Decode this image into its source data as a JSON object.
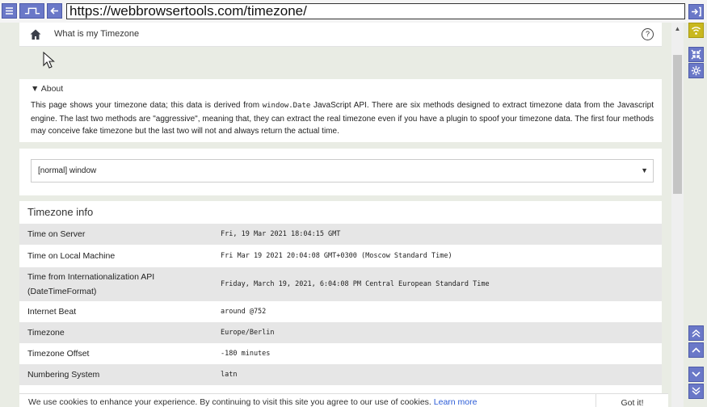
{
  "browser": {
    "url": "https://webbrowsertools.com/timezone/"
  },
  "header": {
    "title": "What is my Timezone",
    "help_label": "?"
  },
  "about": {
    "title": "▼ About",
    "text_1": "This page shows your timezone data; this data is derived from ",
    "code": "window.Date",
    "text_2": " JavaScript API. There are six methods designed to extract timezone data from the Javascript engine. The last two methods are \"aggressive\", meaning that, they can extract the real timezone even if you have a plugin to spoof your timezone data. The first four methods may conceive fake timezone but the last two will not and always return the actual time."
  },
  "selector": {
    "value": "[normal] window",
    "arrow": "▼"
  },
  "timezone_info": {
    "title": "Timezone info",
    "rows": [
      {
        "label": "Time on Server",
        "value": "Fri, 19 Mar 2021 18:04:15 GMT"
      },
      {
        "label": "Time on Local Machine",
        "value": "Fri Mar 19 2021 20:04:08 GMT+0300 (Moscow Standard Time)"
      },
      {
        "label": "Time from Internationalization API (DateTimeFormat)",
        "value": "Friday, March 19, 2021, 6:04:08 PM Central European Standard Time"
      },
      {
        "label": "Internet Beat",
        "value": "around @752"
      },
      {
        "label": "Timezone",
        "value": "Europe/Berlin"
      },
      {
        "label": "Timezone Offset",
        "value": "-180 minutes"
      },
      {
        "label": "Numbering System",
        "value": "latn"
      }
    ]
  },
  "cookie": {
    "text": "We use cookies to enhance your experience. By continuing to visit this site you agree to our use of cookies.",
    "link": "Learn more",
    "button": "Got it!"
  },
  "icons": {
    "menu": "menu-icon",
    "signal": "signal-icon",
    "back": "back-arrow-icon",
    "enter": "enter-icon",
    "wifi": "wifi-icon",
    "shrink": "shrink-icon",
    "settings": "gear-icon",
    "double_up": "double-chevron-up-icon",
    "up": "chevron-up-icon",
    "down": "chevron-down-icon",
    "double_down": "double-chevron-down-icon"
  },
  "colors": {
    "tool_blue": "#6a78c8",
    "tool_yellow": "#c9b81e",
    "link": "#2a5bd7"
  }
}
